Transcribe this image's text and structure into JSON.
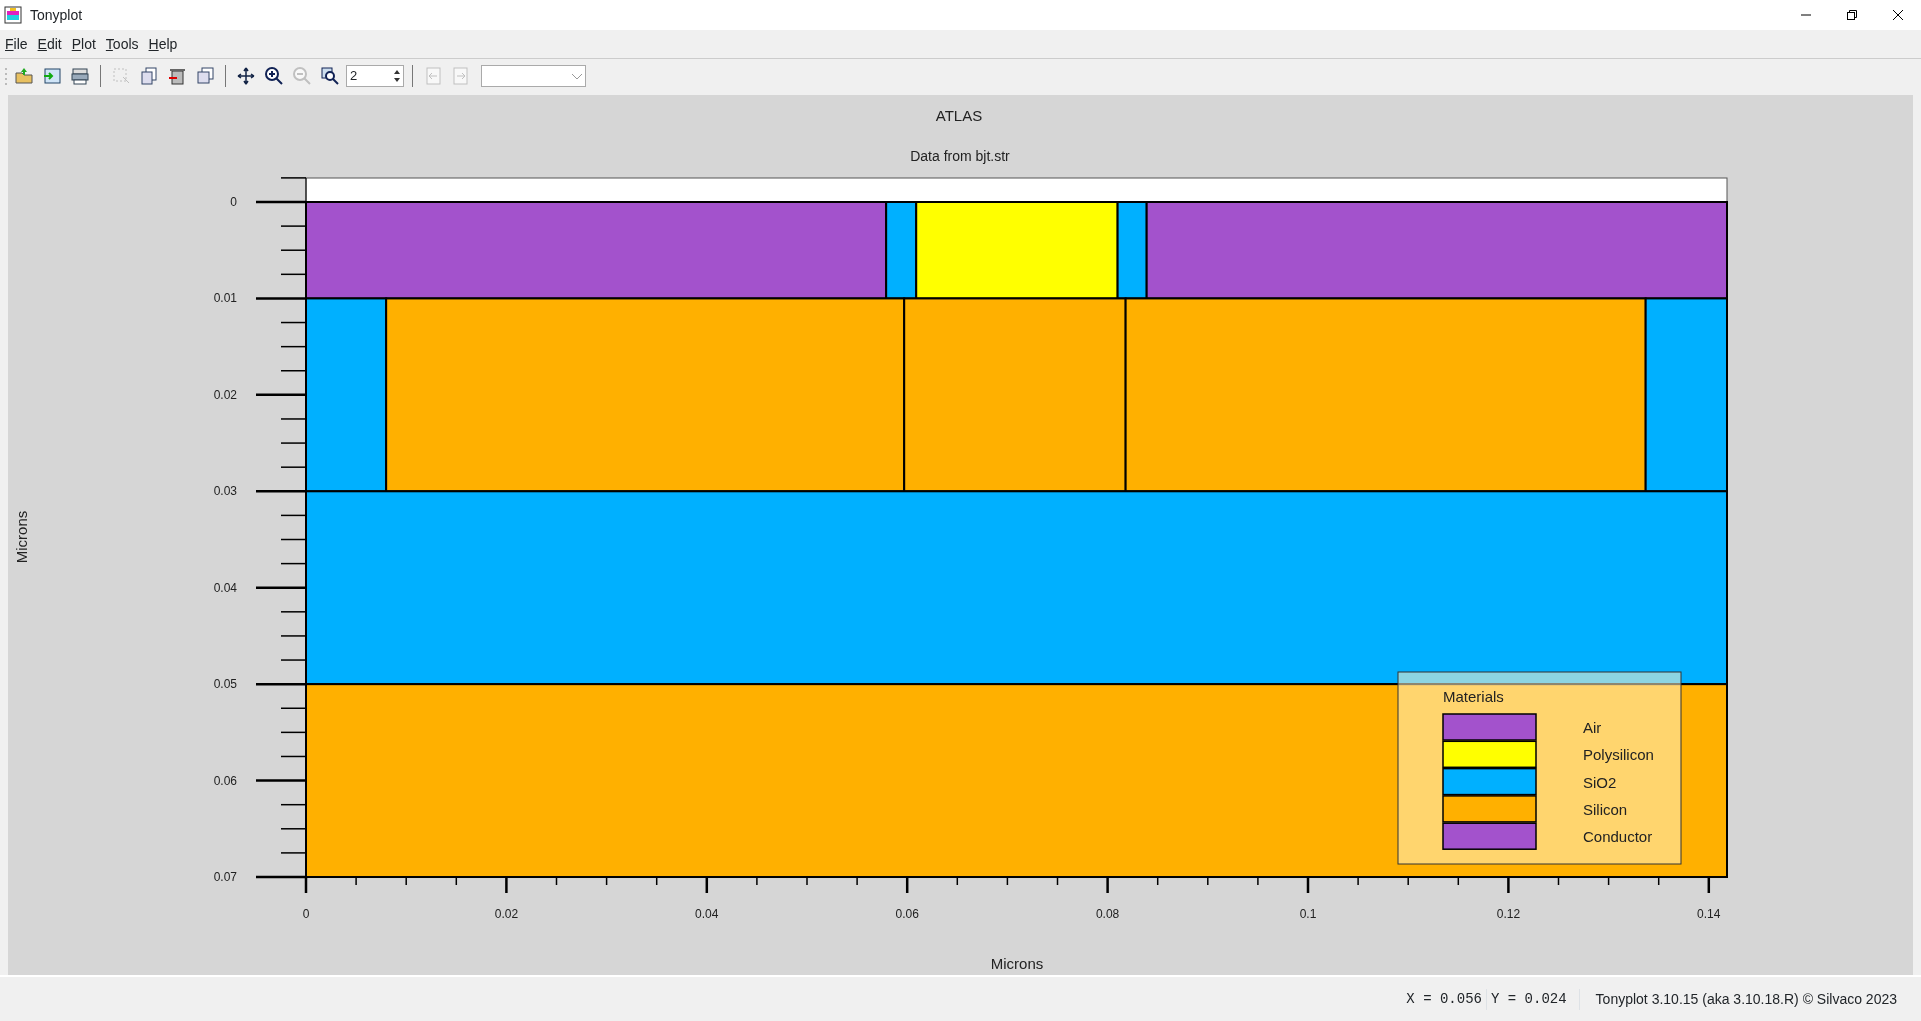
{
  "window": {
    "title": "Tonyplot"
  },
  "menu": [
    "File",
    "Edit",
    "Plot",
    "Tools",
    "Help"
  ],
  "toolbar": {
    "tools_left": [
      {
        "kind": "folder",
        "disabled": false
      },
      {
        "kind": "import",
        "disabled": false
      },
      {
        "kind": "printer",
        "disabled": false
      },
      {
        "kind": "select",
        "disabled": true
      },
      {
        "kind": "copy",
        "disabled": false
      },
      {
        "kind": "trash",
        "disabled": false
      },
      {
        "kind": "pages",
        "disabled": false
      },
      {
        "kind": "move",
        "disabled": false
      },
      {
        "kind": "zoomin",
        "disabled": false
      },
      {
        "kind": "zoomout",
        "disabled": true
      },
      {
        "kind": "zoombox",
        "disabled": false
      }
    ],
    "spinner_value": "2",
    "tools_right": [
      {
        "kind": "back",
        "disabled": true
      },
      {
        "kind": "forward",
        "disabled": true
      }
    ]
  },
  "plot": {
    "title": "ATLAS",
    "subtitle": "Data from bjt.str",
    "xlabel": "Microns",
    "ylabel": "Microns",
    "xticks": [
      "0",
      "0.02",
      "0.04",
      "0.06",
      "0.08",
      "0.1",
      "0.12",
      "0.14"
    ],
    "yticks": [
      "0",
      "0.01",
      "0.02",
      "0.03",
      "0.04",
      "0.05",
      "0.06",
      "0.07"
    ],
    "legend": {
      "title": "Materials",
      "items": [
        {
          "label": "Air",
          "color": "#a352cc"
        },
        {
          "label": "Polysilicon",
          "color": "#ffff00"
        },
        {
          "label": "SiO2",
          "color": "#00b0ff"
        },
        {
          "label": "Silicon",
          "color": "#ffb000"
        },
        {
          "label": "Conductor",
          "color": "#a352cc"
        }
      ]
    }
  },
  "status_bar": {
    "x_reading": "X = 0.056",
    "y_reading": "Y = 0.024",
    "version": "Tonyplot 3.10.15 (aka 3.10.18.R) © Silvaco 2023"
  }
}
